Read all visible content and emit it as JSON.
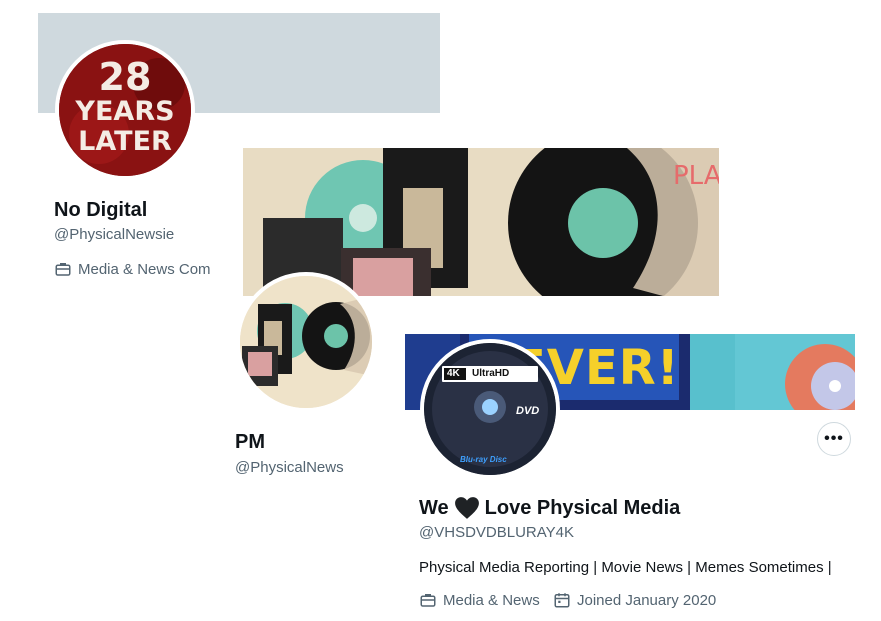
{
  "profiles": [
    {
      "display_name": "No Digital",
      "handle": "@PhysicalNewsie",
      "category": "Media & News Com",
      "avatar_text": [
        "28",
        "YEARS",
        "LATER"
      ]
    },
    {
      "display_name": "PM",
      "handle": "@PhysicalNews"
    },
    {
      "display_name_before": "We",
      "display_name_after": "Love Physical Media",
      "handle": "@VHSDVDBLURAY4K",
      "bio": "Physical Media Reporting | Movie News | Memes Sometimes |",
      "category": "Media & News",
      "joined": "Joined January 2020",
      "more_label": "•••",
      "banner_text": "EVER!",
      "avatar_text": {
        "top_4k": "4K",
        "top_ultra": "UltraHD",
        "dvd": "DVD",
        "bluray": "Blu-ray Disc"
      }
    }
  ],
  "colors": {
    "banner_gray": "#cfd9de",
    "secondary_text": "#536471",
    "primary_text": "#0f1419",
    "poster_red": "#7d0e0e"
  },
  "icons": [
    "briefcase-icon",
    "calendar-icon",
    "heart-icon",
    "more-icon"
  ]
}
